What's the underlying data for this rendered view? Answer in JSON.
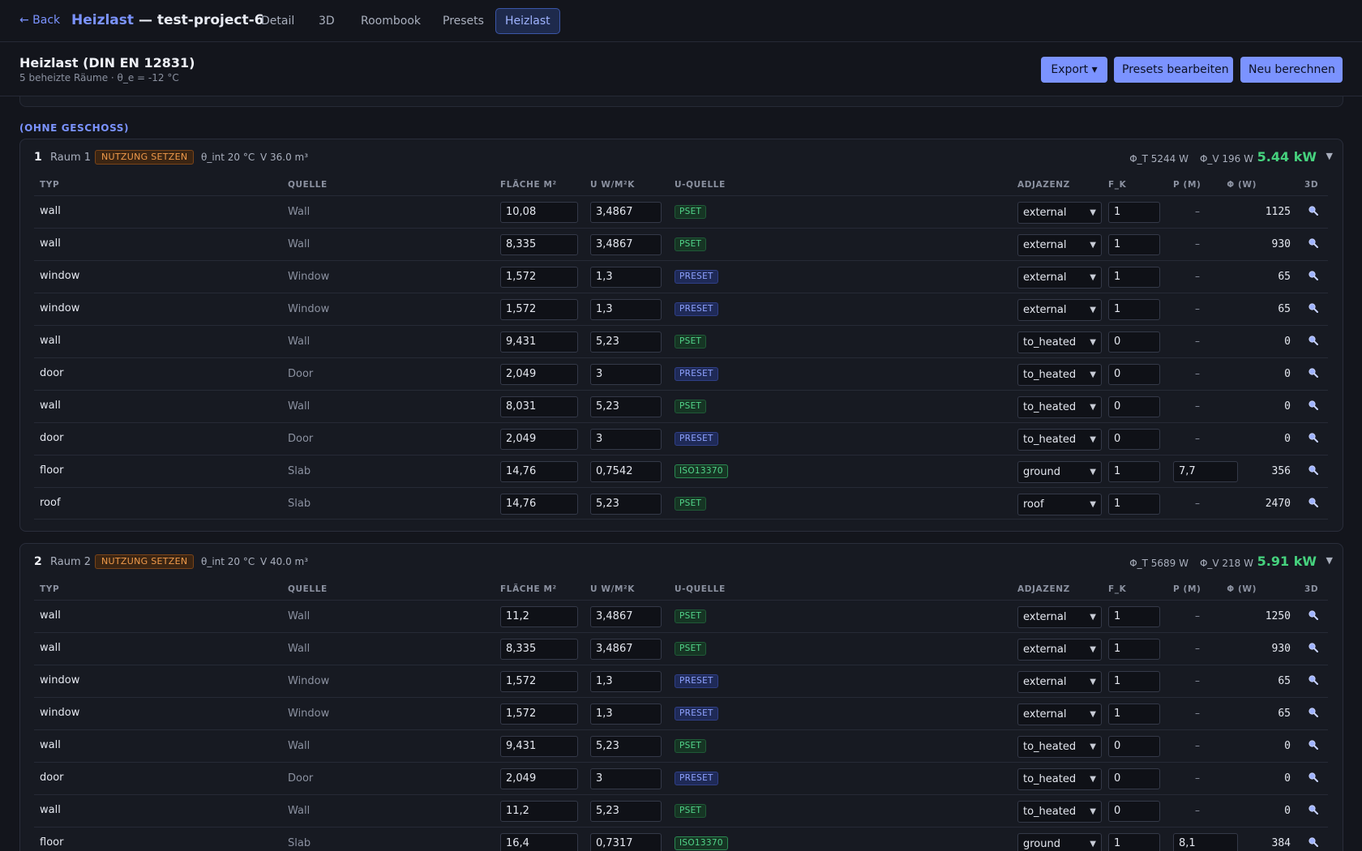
{
  "nav": {
    "back": "← Back",
    "brand": "Heizlast",
    "project": " — test-project-6",
    "tabs": [
      {
        "label": "Detail"
      },
      {
        "label": "3D"
      },
      {
        "label": "Roombook"
      },
      {
        "label": "Presets"
      },
      {
        "label": "Heizlast",
        "active": true
      }
    ]
  },
  "header": {
    "title": "Heizlast (DIN EN 12831)",
    "subtitle": "5 beheizte Räume · θ_e = -12 °C",
    "export_label": "Export ▾",
    "presets_label": "Presets bearbeiten",
    "recalc_label": "Neu berechnen"
  },
  "section_label": "(OHNE GESCHOSS)",
  "columns": {
    "typ": "TYP",
    "quelle": "QUELLE",
    "flaeche": "FLÄCHE M²",
    "u": "U W/M²K",
    "uquelle": "U-QUELLE",
    "adjazenz": "ADJAZENZ",
    "fk": "F_K",
    "p": "P (M)",
    "phi": "Φ (W)",
    "d3": "3D"
  },
  "colors": {
    "accent": "#7b93ff",
    "total_green": "#46d27e",
    "usage_orange": "#f09a4a"
  },
  "rooms": [
    {
      "number": "1",
      "name": "Raum 1",
      "usage_label": "NUTZUNG SETZEN",
      "theta_int": "θ_int 20 °C",
      "volume": "V 36.0 m³",
      "phi_t": "Φ_T 5244 W",
      "phi_v": "Φ_V 196 W",
      "total": "5.44 kW",
      "rows": [
        {
          "typ": "wall",
          "quelle": "Wall",
          "flaeche": "10,08",
          "u": "3,4867",
          "uquelle": "PSET",
          "adj": "external",
          "fk": "1",
          "p": "–",
          "phi": "1125"
        },
        {
          "typ": "wall",
          "quelle": "Wall",
          "flaeche": "8,335",
          "u": "3,4867",
          "uquelle": "PSET",
          "adj": "external",
          "fk": "1",
          "p": "–",
          "phi": "930"
        },
        {
          "typ": "window",
          "quelle": "Window",
          "flaeche": "1,572",
          "u": "1,3",
          "uquelle": "PRESET",
          "adj": "external",
          "fk": "1",
          "p": "–",
          "phi": "65"
        },
        {
          "typ": "window",
          "quelle": "Window",
          "flaeche": "1,572",
          "u": "1,3",
          "uquelle": "PRESET",
          "adj": "external",
          "fk": "1",
          "p": "–",
          "phi": "65"
        },
        {
          "typ": "wall",
          "quelle": "Wall",
          "flaeche": "9,431",
          "u": "5,23",
          "uquelle": "PSET",
          "adj": "to_heated",
          "fk": "0",
          "p": "–",
          "phi": "0"
        },
        {
          "typ": "door",
          "quelle": "Door",
          "flaeche": "2,049",
          "u": "3",
          "uquelle": "PRESET",
          "adj": "to_heated",
          "fk": "0",
          "p": "–",
          "phi": "0"
        },
        {
          "typ": "wall",
          "quelle": "Wall",
          "flaeche": "8,031",
          "u": "5,23",
          "uquelle": "PSET",
          "adj": "to_heated",
          "fk": "0",
          "p": "–",
          "phi": "0"
        },
        {
          "typ": "door",
          "quelle": "Door",
          "flaeche": "2,049",
          "u": "3",
          "uquelle": "PRESET",
          "adj": "to_heated",
          "fk": "0",
          "p": "–",
          "phi": "0"
        },
        {
          "typ": "floor",
          "quelle": "Slab",
          "flaeche": "14,76",
          "u": "0,7542",
          "uquelle": "ISO13370",
          "adj": "ground",
          "fk": "1",
          "p": "7,7",
          "phi": "356"
        },
        {
          "typ": "roof",
          "quelle": "Slab",
          "flaeche": "14,76",
          "u": "5,23",
          "uquelle": "PSET",
          "adj": "roof",
          "fk": "1",
          "p": "–",
          "phi": "2470"
        }
      ]
    },
    {
      "number": "2",
      "name": "Raum 2",
      "usage_label": "NUTZUNG SETZEN",
      "theta_int": "θ_int 20 °C",
      "volume": "V 40.0 m³",
      "phi_t": "Φ_T 5689 W",
      "phi_v": "Φ_V 218 W",
      "total": "5.91 kW",
      "rows": [
        {
          "typ": "wall",
          "quelle": "Wall",
          "flaeche": "11,2",
          "u": "3,4867",
          "uquelle": "PSET",
          "adj": "external",
          "fk": "1",
          "p": "–",
          "phi": "1250"
        },
        {
          "typ": "wall",
          "quelle": "Wall",
          "flaeche": "8,335",
          "u": "3,4867",
          "uquelle": "PSET",
          "adj": "external",
          "fk": "1",
          "p": "–",
          "phi": "930"
        },
        {
          "typ": "window",
          "quelle": "Window",
          "flaeche": "1,572",
          "u": "1,3",
          "uquelle": "PRESET",
          "adj": "external",
          "fk": "1",
          "p": "–",
          "phi": "65"
        },
        {
          "typ": "window",
          "quelle": "Window",
          "flaeche": "1,572",
          "u": "1,3",
          "uquelle": "PRESET",
          "adj": "external",
          "fk": "1",
          "p": "–",
          "phi": "65"
        },
        {
          "typ": "wall",
          "quelle": "Wall",
          "flaeche": "9,431",
          "u": "5,23",
          "uquelle": "PSET",
          "adj": "to_heated",
          "fk": "0",
          "p": "–",
          "phi": "0"
        },
        {
          "typ": "door",
          "quelle": "Door",
          "flaeche": "2,049",
          "u": "3",
          "uquelle": "PRESET",
          "adj": "to_heated",
          "fk": "0",
          "p": "–",
          "phi": "0"
        },
        {
          "typ": "wall",
          "quelle": "Wall",
          "flaeche": "11,2",
          "u": "5,23",
          "uquelle": "PSET",
          "adj": "to_heated",
          "fk": "0",
          "p": "–",
          "phi": "0"
        },
        {
          "typ": "floor",
          "quelle": "Slab",
          "flaeche": "16,4",
          "u": "0,7317",
          "uquelle": "ISO13370",
          "adj": "ground",
          "fk": "1",
          "p": "8,1",
          "phi": "384"
        }
      ]
    }
  ]
}
